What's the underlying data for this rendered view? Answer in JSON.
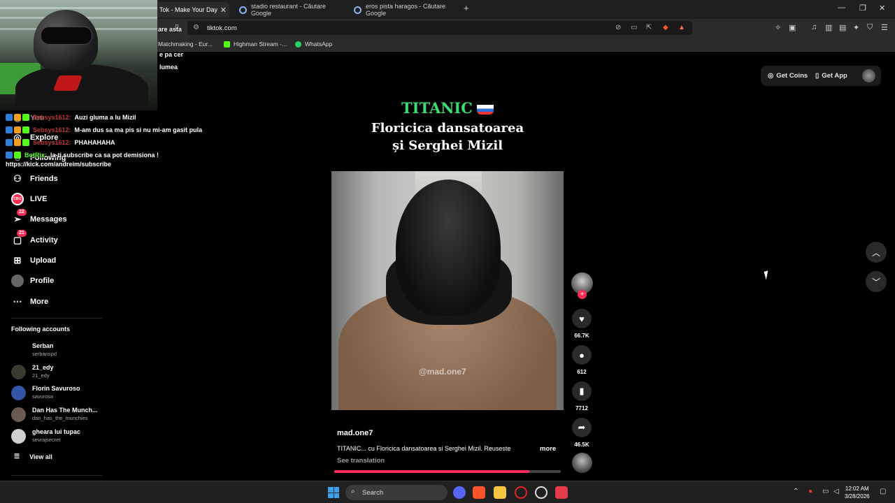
{
  "browser": {
    "tabs": [
      {
        "label": "Tok - Make Your Day",
        "active": true
      },
      {
        "label": "stadio restaurant - Căutare Google",
        "active": false
      },
      {
        "label": "eros pista haragos - Căutare Google",
        "active": false
      }
    ],
    "url": "tiktok.com",
    "bookmarks": [
      "Matchmaking - Eur...",
      "Highman Stream -...",
      "WhatsApp"
    ]
  },
  "overlay": {
    "snippets": [
      "are asta",
      "e pa cer",
      "lumea"
    ],
    "chat": [
      {
        "user": "Sebsys1612:",
        "message": "Auzi gluma a lu Mizil",
        "user_color": "red"
      },
      {
        "user": "Sebsys1612:",
        "message": "M-am dus sa ma pis si nu mi-am gasit pula",
        "user_color": "red"
      },
      {
        "user": "Sebsys1612:",
        "message": "PHAHAHAHA",
        "user_color": "red"
      },
      {
        "user": "BotRix:",
        "message": "Ia-ti subscribe ca sa pot demisiona !",
        "user_color": "green"
      }
    ],
    "kick_url": "https://kick.com/andreim/subscribe"
  },
  "sidebar": {
    "nav": [
      {
        "label": "You",
        "icon": "compass-icon"
      },
      {
        "label": "Explore",
        "icon": "compass-icon"
      },
      {
        "label": "Following",
        "icon": "user-icon"
      },
      {
        "label": "Friends",
        "icon": "friends-icon"
      },
      {
        "label": "LIVE",
        "icon": "live-icon"
      },
      {
        "label": "Messages",
        "icon": "paper-plane-icon",
        "count": "22"
      },
      {
        "label": "Activity",
        "icon": "inbox-icon",
        "count": "21"
      },
      {
        "label": "Upload",
        "icon": "plus-square-icon"
      },
      {
        "label": "Profile",
        "icon": "avatar-icon"
      },
      {
        "label": "More",
        "icon": "ellipsis-icon"
      }
    ],
    "live_badge": "CB\\1",
    "following_title": "Following accounts",
    "accounts": [
      {
        "name": "Serban",
        "handle": "serbanspd"
      },
      {
        "name": "21_edy",
        "handle": "21_edy"
      },
      {
        "name": "Florin Savuroso",
        "handle": "savuroso"
      },
      {
        "name": "Dan Has The Munch...",
        "handle": "dan_has_the_munchies"
      },
      {
        "name": "gheara lui tupac",
        "handle": "sevrajsecret"
      }
    ],
    "view_all": "View all"
  },
  "header": {
    "get_coins": "Get Coins",
    "get_app": "Get App"
  },
  "video": {
    "title_line1": "TITANIC",
    "title_line2": "Floricica dansatoarea",
    "title_line3": "și Serghei Mizil",
    "watermark": "@mad.one7",
    "author": "mad.one7",
    "description": "TITANIC... cu Floricica dansatoarea si Serghei Mizil. Reuseste",
    "more": "more",
    "see_translation": "See translation",
    "progress": 0.86,
    "likes": "66.7K",
    "comments": "612",
    "saves": "7712",
    "shares": "46.5K"
  },
  "taskbar": {
    "search_placeholder": "Search",
    "time": "12:02 AM",
    "date": "3/28/2026"
  },
  "colors": {
    "accent": "#fe2c55",
    "title_green": "#3ddc74",
    "chat_green": "#53fc18"
  }
}
